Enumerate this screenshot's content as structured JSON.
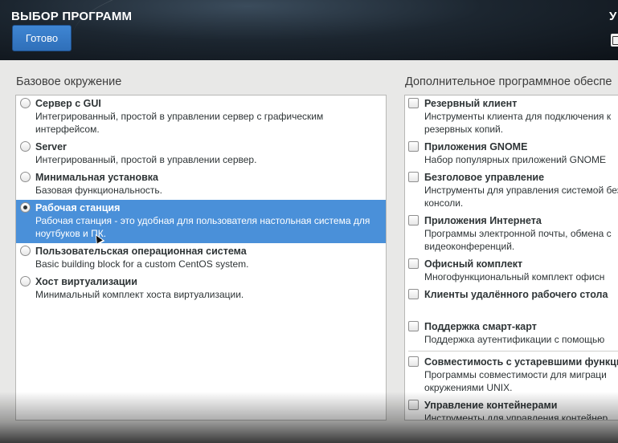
{
  "header": {
    "title": "ВЫБОР ПРОГРАММ",
    "done_label": "Готово",
    "right_title_fragment": "У"
  },
  "base_environment": {
    "label": "Базовое окружение",
    "items": [
      {
        "name": "Сервер с GUI",
        "desc": "Интегрированный, простой в управлении сервер с графическим интерфейсом.",
        "selected": false
      },
      {
        "name": "Server",
        "desc": "Интегрированный, простой в управлении сервер.",
        "selected": false
      },
      {
        "name": "Минимальная установка",
        "desc": "Базовая функциональность.",
        "selected": false
      },
      {
        "name": "Рабочая станция",
        "desc": "Рабочая станция - это удобная для пользователя настольная система для ноутбуков и ПК.",
        "selected": true
      },
      {
        "name": "Пользовательская операционная система",
        "desc": "Basic building block for a custom CentOS system.",
        "selected": false
      },
      {
        "name": "Хост виртуализации",
        "desc": "Минимальный комплект хоста виртуализации.",
        "selected": false
      }
    ]
  },
  "addons": {
    "label": "Дополнительное программное обеспе",
    "items": [
      {
        "name": "Резервный клиент",
        "desc": "Инструменты клиента для подключения к резервных копий.",
        "checked": false
      },
      {
        "name": "Приложения GNOME",
        "desc": "Набор популярных приложений GNOME",
        "checked": false
      },
      {
        "name": "Безголовое управление",
        "desc": "Инструменты для управления системой без консоли.",
        "checked": false
      },
      {
        "name": "Приложения Интернета",
        "desc": "Программы электронной почты, обмена с видеоконференций.",
        "checked": false
      },
      {
        "name": "Офисный комплект",
        "desc": "Многофункциональный комплект офисн",
        "checked": false
      },
      {
        "name": "Клиенты удалённого рабочего стола",
        "desc": "",
        "checked": false
      },
      {
        "name": "Поддержка смарт-карт",
        "desc": "Поддержка аутентификации с помощью",
        "checked": false
      },
      {
        "name": "Совместимость с устаревшими функци",
        "desc": "Программы совместимости для миграци окружениями UNIX.",
        "checked": false
      },
      {
        "name": "Управление контейнерами",
        "desc": "Инструменты для управления контейнер",
        "checked": false
      }
    ]
  }
}
